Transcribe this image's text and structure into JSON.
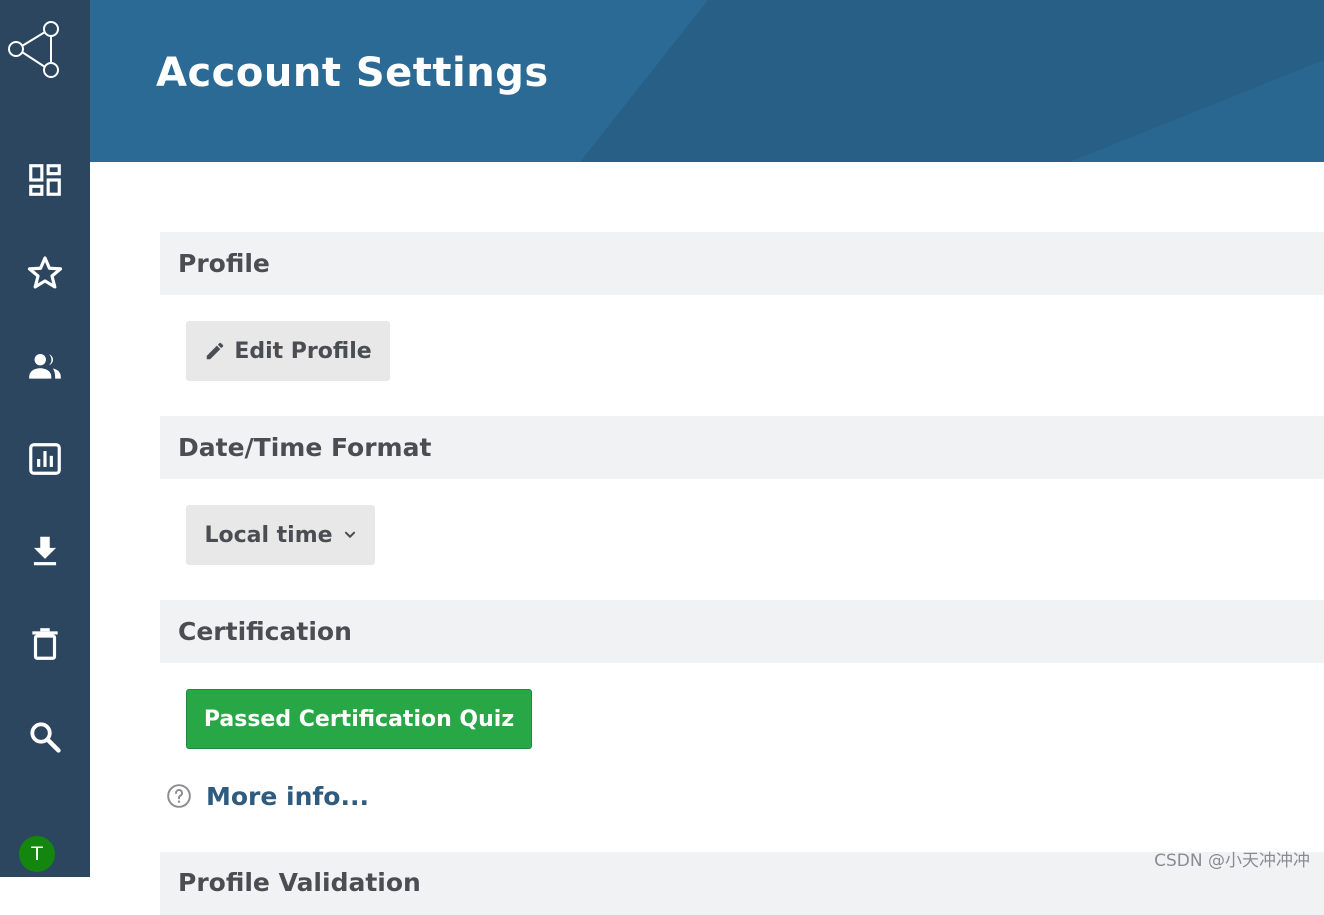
{
  "sidebar": {
    "logo_icon": "share-network-icon",
    "items": [
      {
        "icon": "dashboard-icon"
      },
      {
        "icon": "star-icon"
      },
      {
        "icon": "people-icon"
      },
      {
        "icon": "report-chart-icon"
      },
      {
        "icon": "download-icon"
      },
      {
        "icon": "trash-icon"
      },
      {
        "icon": "search-icon"
      }
    ],
    "avatar_initial": "T",
    "avatar_color": "#13860f"
  },
  "header": {
    "title": "Account Settings"
  },
  "sections": {
    "profile": {
      "title": "Profile",
      "edit_button_label": "Edit Profile"
    },
    "datetime": {
      "title": "Date/Time Format",
      "selected_value": "Local time"
    },
    "certification": {
      "title": "Certification",
      "status_button_label": "Passed Certification Quiz",
      "more_info_label": "More info..."
    },
    "profile_validation": {
      "title": "Profile Validation"
    }
  },
  "colors": {
    "sidebar": "#2c4660",
    "header": "#2a6a94",
    "accent_green": "#27a745",
    "link": "#2e5b7e"
  },
  "watermark": "CSDN @小天冲冲冲"
}
